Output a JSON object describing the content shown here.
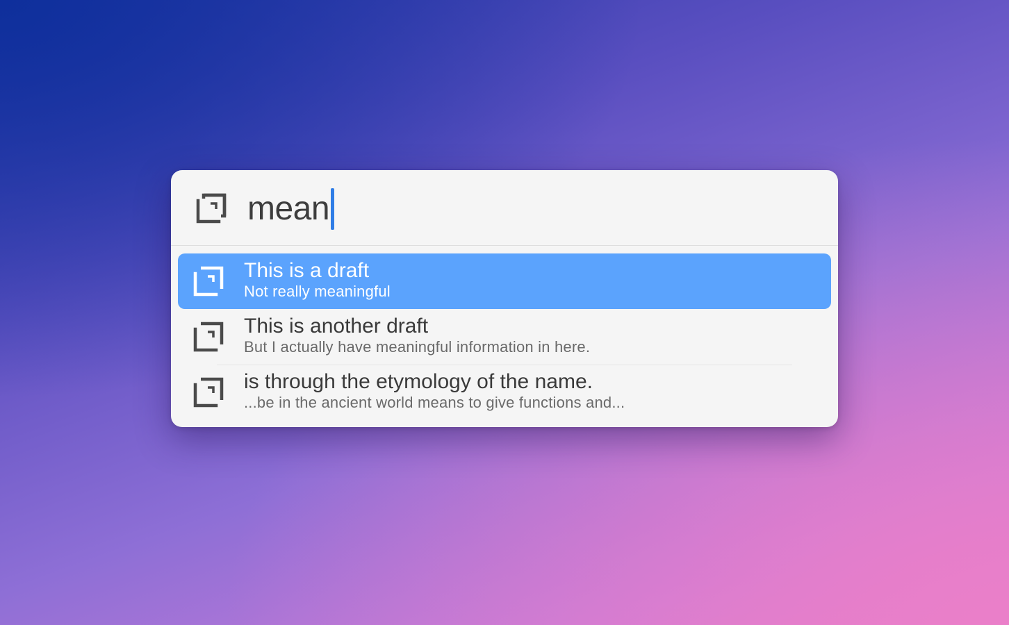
{
  "search": {
    "query": "mean",
    "icon": "draft-icon"
  },
  "results": [
    {
      "title": "This is a draft",
      "subtitle": "Not really meaningful",
      "icon": "draft-icon",
      "selected": true
    },
    {
      "title": "This is another draft",
      "subtitle": "But I actually have meaningful information in here.",
      "icon": "draft-icon",
      "selected": false
    },
    {
      "title": "is through the etymology of the name.",
      "subtitle": "...be in the ancient world means to give functions and...",
      "icon": "draft-icon",
      "selected": false
    }
  ],
  "colors": {
    "selection": "#5ba3fd",
    "caret": "#2f7de6",
    "panel": "#f5f5f5"
  }
}
